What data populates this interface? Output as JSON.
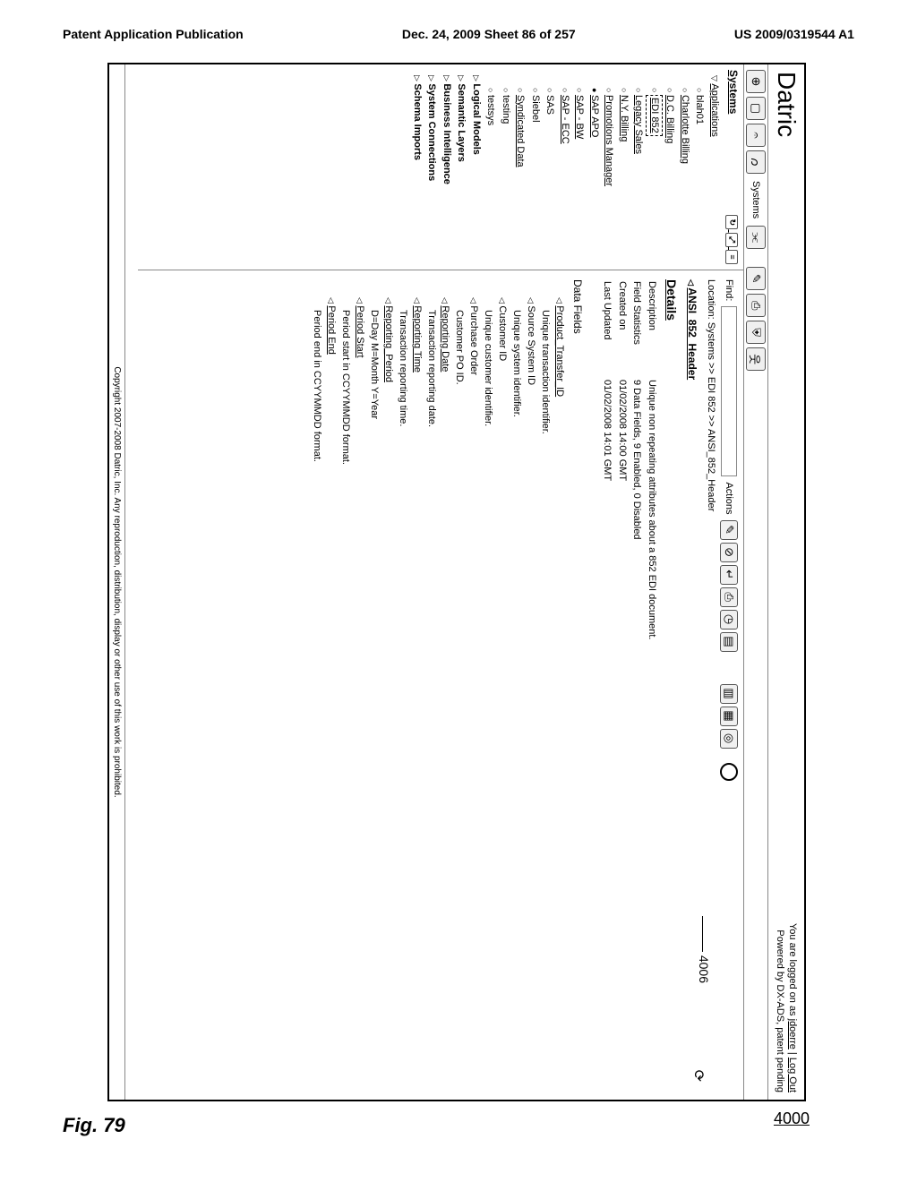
{
  "patent": {
    "pub_left": "Patent Application Publication",
    "pub_center": "Dec. 24, 2009  Sheet 86 of 257",
    "pub_right": "US 2009/0319544 A1"
  },
  "figure": {
    "label": "Fig. 79",
    "ref_main": "4000",
    "ref_callout": "4006"
  },
  "app": {
    "title": "Datric",
    "login_prefix": "You are logged on as ",
    "login_user": "jdoerre",
    "login_sep": " | ",
    "logout": "Log Out",
    "powered": "Powered by DX-ADS, patent pending"
  },
  "toolbar": {
    "systems_label": "Systems"
  },
  "sidebar": {
    "title": "Systems",
    "root": "Applications",
    "items": [
      {
        "label": "blah01",
        "kind": "circ"
      },
      {
        "label": "Charlotte Billing",
        "kind": "circ",
        "ul": true
      },
      {
        "label": "D.C. Billing",
        "kind": "circ",
        "ul": true
      },
      {
        "label": "EDI 852",
        "kind": "circ",
        "ul": true,
        "boxed": true
      },
      {
        "label": "Legacy Sales",
        "kind": "circ",
        "ul": true
      },
      {
        "label": "N.Y. Billing",
        "kind": "circ",
        "ul": true
      },
      {
        "label": "Promotions Manager",
        "kind": "circ",
        "ul": true
      },
      {
        "label": "SAP APO",
        "kind": "dot",
        "ul": true
      },
      {
        "label": "SAP - BW",
        "kind": "circ",
        "ul": true
      },
      {
        "label": "SAP - ECC",
        "kind": "circ",
        "ul": true
      },
      {
        "label": "SAS",
        "kind": "circ"
      },
      {
        "label": "Siebel",
        "kind": "circ"
      },
      {
        "label": "Syndicated Data",
        "kind": "circ",
        "ul": true
      },
      {
        "label": "testing",
        "kind": "circ"
      },
      {
        "label": "testsys",
        "kind": "circ"
      }
    ],
    "branches": [
      "Logical Models",
      "Semantic Layers",
      "Business Intelligence",
      "System Connections",
      "Schema Imports"
    ]
  },
  "main": {
    "find_label": "Find:",
    "actions_label": "Actions",
    "location_prefix": "Location:",
    "location_path": "Systems >> EDI 852 >> ANSI_852_Header",
    "item_name": "ANSI_852_Header",
    "details_heading": "Details",
    "kv": {
      "description_k": "Description",
      "description_v": "Unique non repeating attributes about a 852 EDI document.",
      "fieldstats_k": "Field Statistics",
      "fieldstats_v": "9 Data Fields, 9 Enabled, 0 Disabled",
      "created_k": "Created on",
      "created_v": "01/02/2008 14:00 GMT",
      "updated_k": "Last Updated",
      "updated_v": "01/02/2008 14:01 GMT"
    },
    "datafields_heading": "Data Fields",
    "fields": [
      {
        "name": "Product_Transfer_ID",
        "desc": "Unique transaction identifier."
      },
      {
        "name": "Source System ID",
        "desc": "Unique system identifier.",
        "plain_name": true
      },
      {
        "name": "Customer ID",
        "desc": "Unique customer identifier.",
        "plain_name": true
      },
      {
        "name": "Purchase Order",
        "desc": "Customer PO ID.",
        "plain_name": true
      },
      {
        "name": "Reporting Date",
        "desc": "Transaction reporting date."
      },
      {
        "name": "Reporting Time",
        "desc": "Transaction reporting time."
      },
      {
        "name": "Reporting_Period",
        "desc": "D=Day M=Month Y=Year"
      },
      {
        "name": "Period Start",
        "desc": "Period start in CCYYMMDD format."
      },
      {
        "name": "Period End",
        "desc": "Period end in CCYYMMDD format."
      }
    ]
  },
  "footer": {
    "copyright": "Copyright 2007-2008 Datric, Inc.  Any reproduction, distribution, display or other use of this work is prohibited."
  }
}
